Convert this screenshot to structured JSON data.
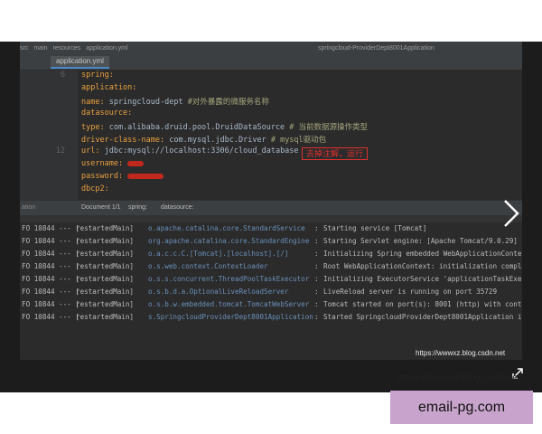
{
  "topbar": {
    "items": [
      "src",
      "main",
      "resources",
      "application.yml"
    ],
    "right": "springcloud-ProviderDept8001Application"
  },
  "tab": {
    "label": "application.yml"
  },
  "editor": {
    "lines": [
      {
        "n": "6",
        "key": "spring:",
        "val": "",
        "comment": ""
      },
      {
        "n": "",
        "key": "  application:",
        "val": "",
        "comment": ""
      },
      {
        "n": "",
        "key": "    name:",
        "val": " springcloud-dept",
        "comment": " #对外暴露的微服务名称"
      },
      {
        "n": "",
        "key": "  datasource:",
        "val": "",
        "comment": ""
      },
      {
        "n": "",
        "key": "    type:",
        "val": " com.alibaba.druid.pool.DruidDataSource",
        "comment": " # 当前数据源操作类型"
      },
      {
        "n": "",
        "key": "    driver-class-name:",
        "val": " com.mysql.jdbc.Driver",
        "comment": " # mysql驱动包"
      },
      {
        "n": "12",
        "key": "    url:",
        "val": " jdbc:mysql://localhost:3306/cloud_database",
        "comment": ""
      },
      {
        "n": "",
        "key": "    username:",
        "val": " ",
        "comment": ""
      },
      {
        "n": "",
        "key": "    password:",
        "val": " ",
        "comment": ""
      },
      {
        "n": "",
        "key": "    dbcp2:",
        "val": "",
        "comment": ""
      }
    ],
    "annotation": "去掉注解，运行"
  },
  "statusbar": {
    "run": "ation",
    "doc": "Document 1/1",
    "crumb1": "spring:",
    "crumb2": "datasource:"
  },
  "console": {
    "rows": [
      {
        "lvl": "FO 10844 --- [",
        "th": " restartedMain]",
        "lg": "o.apache.catalina.core.StandardService",
        "msg": "Starting service [Tomcat]"
      },
      {
        "lvl": "FO 10844 --- [",
        "th": " restartedMain]",
        "lg": "org.apache.catalina.core.StandardEngine",
        "msg": "Starting Servlet engine: [Apache Tomcat/9.0.29]"
      },
      {
        "lvl": "FO 10844 --- [",
        "th": " restartedMain]",
        "lg": "o.a.c.c.C.[Tomcat].[localhost].[/]",
        "msg": "Initializing Spring embedded WebApplicationConte"
      },
      {
        "lvl": "FO 10844 --- [",
        "th": " restartedMain]",
        "lg": "o.s.web.context.ContextLoader",
        "msg": "Root WebApplicationContext: initialization compl"
      },
      {
        "lvl": "FO 10844 --- [",
        "th": " restartedMain]",
        "lg": "o.s.s.concurrent.ThreadPoolTaskExecutor",
        "msg": "Initializing ExecutorService 'applicationTaskExe"
      },
      {
        "lvl": "FO 10844 --- [",
        "th": " restartedMain]",
        "lg": "o.s.b.d.a.OptionalLiveReloadServer",
        "msg": "LiveReload server is running on port 35729"
      },
      {
        "lvl": "FO 10844 --- [",
        "th": " restartedMain]",
        "lg": "o.s.b.w.embedded.tomcat.TomcatWebServer",
        "msg": "Tomcat started on port(s): 8001 (http) with cont"
      },
      {
        "lvl": "FO 10844 --- [",
        "th": " restartedMain]",
        "lg": "s.SpringcloudProviderDept8001Application",
        "msg": "Started SpringcloudProviderDept8001Application in"
      }
    ],
    "inner_watermark": "https://wwwxz.blog.csdn.net"
  },
  "overlay": {
    "watermark": "https://wwwxz.blog.csdn.net",
    "email": "email-pg.com"
  },
  "colors": {
    "red": "#e03030",
    "email_bg": "#c8a4cc"
  }
}
